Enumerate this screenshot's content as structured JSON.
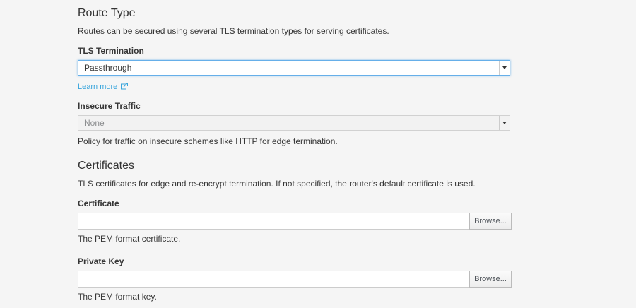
{
  "route_type": {
    "heading": "Route Type",
    "description": "Routes can be secured using several TLS termination types for serving certificates."
  },
  "tls_termination": {
    "label": "TLS Termination",
    "value": "Passthrough",
    "learn_more": "Learn more",
    "icon": "external-link-icon"
  },
  "insecure_traffic": {
    "label": "Insecure Traffic",
    "value": "None",
    "help": "Policy for traffic on insecure schemes like HTTP for edge termination."
  },
  "certificates": {
    "heading": "Certificates",
    "description": "TLS certificates for edge and re-encrypt termination. If not specified, the router's default certificate is used."
  },
  "certificate": {
    "label": "Certificate",
    "browse": "Browse...",
    "help": "The PEM format certificate."
  },
  "private_key": {
    "label": "Private Key",
    "browse": "Browse...",
    "help": "The PEM format key."
  }
}
